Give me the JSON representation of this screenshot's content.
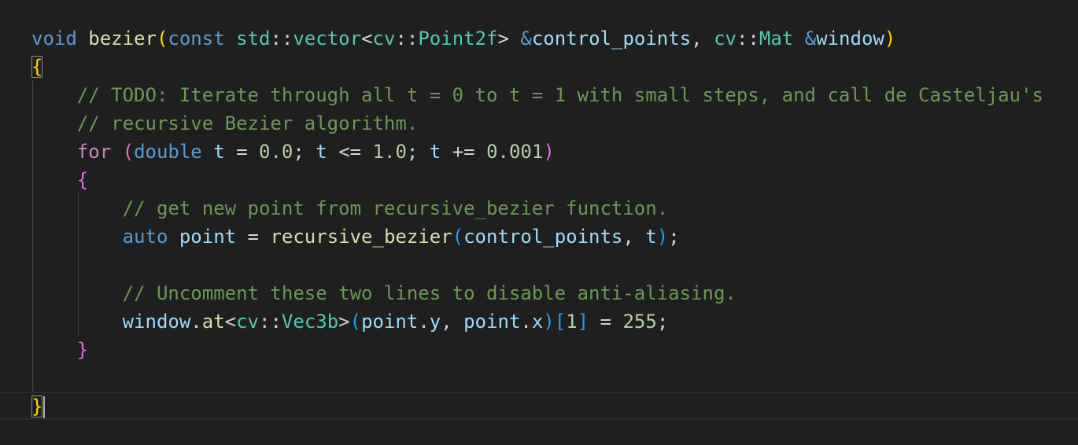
{
  "editor": {
    "lines": [
      {
        "tokens": [
          {
            "t": "void",
            "c": "kw"
          },
          {
            "t": " "
          },
          {
            "t": "bezier",
            "c": "fn"
          },
          {
            "t": "(",
            "c": "b1"
          },
          {
            "t": "const",
            "c": "kw"
          },
          {
            "t": " "
          },
          {
            "t": "std",
            "c": "type"
          },
          {
            "t": "::",
            "c": "op"
          },
          {
            "t": "vector",
            "c": "type"
          },
          {
            "t": "<",
            "c": "op"
          },
          {
            "t": "cv",
            "c": "type"
          },
          {
            "t": "::",
            "c": "op"
          },
          {
            "t": "Point2f",
            "c": "type"
          },
          {
            "t": ">",
            "c": "op"
          },
          {
            "t": " "
          },
          {
            "t": "&",
            "c": "kw"
          },
          {
            "t": "control_points",
            "c": "var"
          },
          {
            "t": ", ",
            "c": "op"
          },
          {
            "t": "cv",
            "c": "type"
          },
          {
            "t": "::",
            "c": "op"
          },
          {
            "t": "Mat",
            "c": "type"
          },
          {
            "t": " "
          },
          {
            "t": "&",
            "c": "kw"
          },
          {
            "t": "window",
            "c": "var"
          },
          {
            "t": ")",
            "c": "b1"
          }
        ]
      },
      {
        "tokens": [
          {
            "t": "{",
            "c": "b1",
            "match": true
          }
        ]
      },
      {
        "tokens": [
          {
            "t": "    "
          },
          {
            "t": "// TODO: Iterate through all t = 0 to t = 1 with small steps, and call de Casteljau's",
            "c": "cm"
          }
        ]
      },
      {
        "tokens": [
          {
            "t": "    "
          },
          {
            "t": "// recursive Bezier algorithm.",
            "c": "cm"
          }
        ]
      },
      {
        "tokens": [
          {
            "t": "    "
          },
          {
            "t": "for",
            "c": "ctrl"
          },
          {
            "t": " "
          },
          {
            "t": "(",
            "c": "b2"
          },
          {
            "t": "double",
            "c": "kw"
          },
          {
            "t": " "
          },
          {
            "t": "t",
            "c": "var"
          },
          {
            "t": " = ",
            "c": "op"
          },
          {
            "t": "0.0",
            "c": "num"
          },
          {
            "t": "; ",
            "c": "op"
          },
          {
            "t": "t",
            "c": "var"
          },
          {
            "t": " <= ",
            "c": "op"
          },
          {
            "t": "1.0",
            "c": "num"
          },
          {
            "t": "; ",
            "c": "op"
          },
          {
            "t": "t",
            "c": "var"
          },
          {
            "t": " += ",
            "c": "op"
          },
          {
            "t": "0.001",
            "c": "num"
          },
          {
            "t": ")",
            "c": "b2"
          }
        ]
      },
      {
        "tokens": [
          {
            "t": "    "
          },
          {
            "t": "{",
            "c": "b2"
          }
        ]
      },
      {
        "tokens": [
          {
            "t": "        "
          },
          {
            "t": "// get new point from recursive_bezier function.",
            "c": "cm"
          }
        ]
      },
      {
        "tokens": [
          {
            "t": "        "
          },
          {
            "t": "auto",
            "c": "kw"
          },
          {
            "t": " "
          },
          {
            "t": "point",
            "c": "var"
          },
          {
            "t": " = ",
            "c": "op"
          },
          {
            "t": "recursive_bezier",
            "c": "fn"
          },
          {
            "t": "(",
            "c": "b3"
          },
          {
            "t": "control_points",
            "c": "var"
          },
          {
            "t": ", ",
            "c": "op"
          },
          {
            "t": "t",
            "c": "var"
          },
          {
            "t": ")",
            "c": "b3"
          },
          {
            "t": ";",
            "c": "op"
          }
        ]
      },
      {
        "tokens": []
      },
      {
        "tokens": [
          {
            "t": "        "
          },
          {
            "t": "// Uncomment these two lines to disable anti-aliasing.",
            "c": "cm"
          }
        ]
      },
      {
        "tokens": [
          {
            "t": "        "
          },
          {
            "t": "window",
            "c": "var"
          },
          {
            "t": ".",
            "c": "op"
          },
          {
            "t": "at",
            "c": "fn"
          },
          {
            "t": "<",
            "c": "op"
          },
          {
            "t": "cv",
            "c": "type"
          },
          {
            "t": "::",
            "c": "op"
          },
          {
            "t": "Vec3b",
            "c": "type"
          },
          {
            "t": ">",
            "c": "op"
          },
          {
            "t": "(",
            "c": "b3"
          },
          {
            "t": "point",
            "c": "var"
          },
          {
            "t": ".",
            "c": "op"
          },
          {
            "t": "y",
            "c": "var"
          },
          {
            "t": ", ",
            "c": "op"
          },
          {
            "t": "point",
            "c": "var"
          },
          {
            "t": ".",
            "c": "op"
          },
          {
            "t": "x",
            "c": "var"
          },
          {
            "t": ")",
            "c": "b3"
          },
          {
            "t": "[",
            "c": "b3"
          },
          {
            "t": "1",
            "c": "num"
          },
          {
            "t": "]",
            "c": "b3"
          },
          {
            "t": " = ",
            "c": "op"
          },
          {
            "t": "255",
            "c": "num"
          },
          {
            "t": ";",
            "c": "op"
          }
        ]
      },
      {
        "tokens": [
          {
            "t": "    "
          },
          {
            "t": "}",
            "c": "b2"
          }
        ]
      },
      {
        "tokens": []
      },
      {
        "tokens": [
          {
            "t": "}",
            "c": "b1",
            "match": true,
            "cursor": true
          }
        ]
      }
    ]
  }
}
